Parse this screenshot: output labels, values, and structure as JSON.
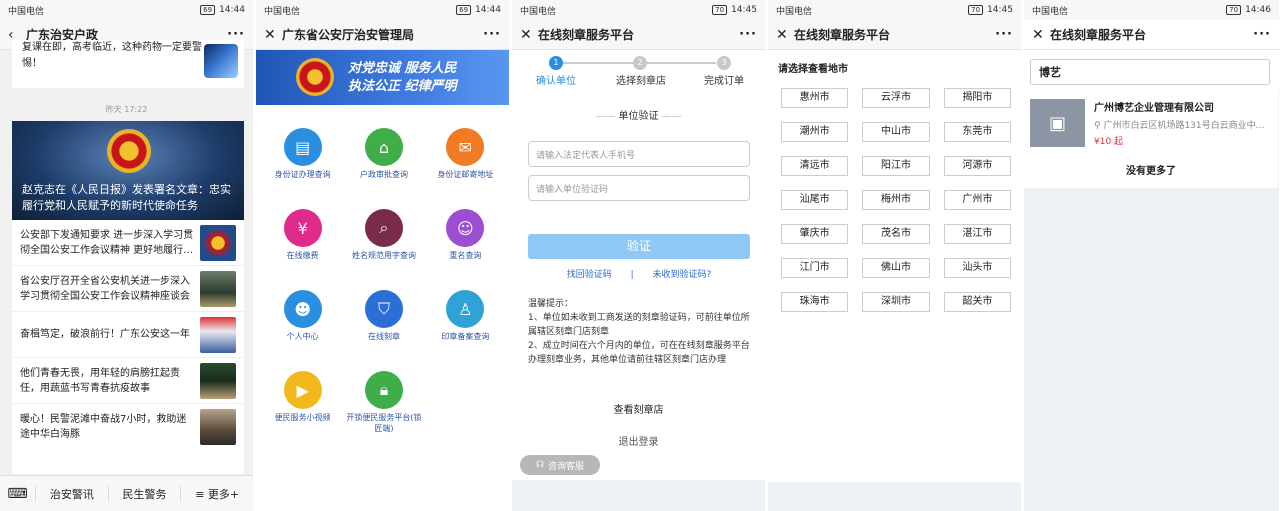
{
  "status_bars": [
    {
      "carrier": "中国电信",
      "battery": "69",
      "time": "14:44"
    },
    {
      "carrier": "中国电信",
      "battery": "69",
      "time": "14:44"
    },
    {
      "carrier": "中国电信",
      "battery": "70",
      "time": "14:45"
    },
    {
      "carrier": "中国电信",
      "battery": "70",
      "time": "14:45"
    },
    {
      "carrier": "中国电信",
      "battery": "70",
      "time": "14:46"
    }
  ],
  "screen1": {
    "title": "广东治安户政",
    "top_card": "复课在即，高考临近，这种药物一定要警惕！",
    "time_label": "昨天 17:22",
    "hero_title": "赵克志在《人民日报》发表署名文章：忠实履行党和人民赋予的新时代使命任务",
    "articles": [
      {
        "text": "公安部下发通知要求 进一步深入学习贯彻全国公安工作会议精神 更好地履行…"
      },
      {
        "text": "省公安厅召开全省公安机关进一步深入学习贯彻全国公安工作会议精神座谈会"
      },
      {
        "text": "奋楫笃定，破浪前行！广东公安这一年"
      },
      {
        "text": "他们青春无畏，用年轻的肩膀扛起责任，用蔬蓝书写青春抗疫故事"
      },
      {
        "text": "暖心！民警泥滩中奋战7小时，救助迷途中华白海豚"
      }
    ],
    "menu": [
      "治安警讯",
      "民生警务",
      "≡ 更多+"
    ]
  },
  "screen2": {
    "title": "广东省公安厅治安管理局",
    "banner_line1": "对党忠诚 服务人民",
    "banner_line2": "执法公正 纪律严明",
    "services": [
      {
        "label": "身份证办理查询",
        "icon": "id-card-icon",
        "color": "#2a8fe0"
      },
      {
        "label": "户政审批查询",
        "icon": "house-check-icon",
        "color": "#3fae49"
      },
      {
        "label": "身份证邮寄地址",
        "icon": "mail-icon",
        "color": "#f07b24"
      },
      {
        "label": "在线缴费",
        "icon": "yuan-icon",
        "color": "#e02a8c"
      },
      {
        "label": "姓名规范用字查询",
        "icon": "search-screen-icon",
        "color": "#7a2a4a"
      },
      {
        "label": "重名查询",
        "icon": "users-icon",
        "color": "#9b4fd0"
      },
      {
        "label": "个人中心",
        "icon": "person-icon",
        "color": "#2a8fe0"
      },
      {
        "label": "在线刻章",
        "icon": "shield-icon",
        "color": "#2a6fd6"
      },
      {
        "label": "印章备案查询",
        "icon": "stamp-icon",
        "color": "#2fa3d6"
      },
      {
        "label": "便民服务小视频",
        "icon": "play-icon",
        "color": "#f2b81c"
      },
      {
        "label": "开锁便民服务平台(锁匠端)",
        "icon": "lock-icon",
        "color": "#3fae49"
      }
    ]
  },
  "screen3": {
    "title": "在线刻章服务平台",
    "steps": [
      "确认单位",
      "选择刻章店",
      "完成订单"
    ],
    "section": "单位验证",
    "phone_placeholder": "请输入法定代表人手机号",
    "code_placeholder": "请输入单位验证码",
    "verify_btn": "验证",
    "link_recover": "找回验证码",
    "link_separator": "|",
    "link_not_received": "未收到验证码?",
    "tips_title": "温馨提示：",
    "tip1": "1、单位如未收到工商发送的刻章验证码，可前往单位所属辖区刻章门店刻章",
    "tip2": "2、成立时间在六个月内的单位，可在在线刻章服务平台办理刻章业务，其他单位请前往辖区刻章门店办理",
    "view_shops": "查看刻章店",
    "logout": "退出登录",
    "customer_service": "咨询客服"
  },
  "screen4": {
    "title": "在线刻章服务平台",
    "hint": "请选择查看地市",
    "cities": [
      "惠州市",
      "云浮市",
      "揭阳市",
      "潮州市",
      "中山市",
      "东莞市",
      "清远市",
      "阳江市",
      "河源市",
      "汕尾市",
      "梅州市",
      "广州市",
      "肇庆市",
      "茂名市",
      "湛江市",
      "江门市",
      "佛山市",
      "汕头市",
      "珠海市",
      "深圳市",
      "韶关市"
    ]
  },
  "screen5": {
    "title": "在线刻章服务平台",
    "search_value": "博艺",
    "result_name": "广州博艺企业管理有限公司",
    "result_address": "广州市白云区机场路131号白云商业中…",
    "result_price": "¥10 起",
    "no_more": "没有更多了"
  }
}
